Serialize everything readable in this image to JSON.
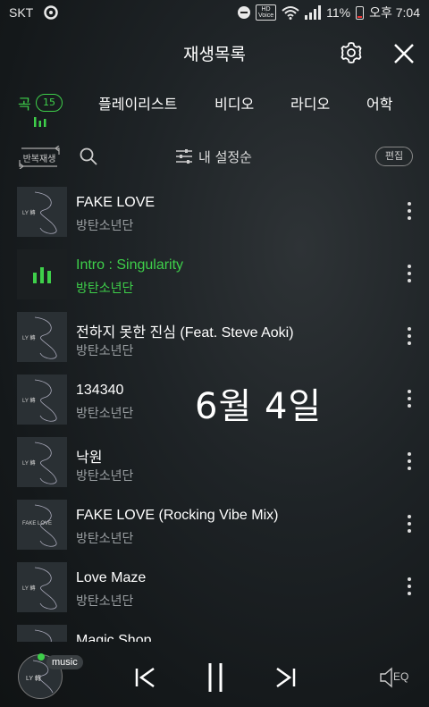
{
  "status_bar": {
    "carrier": "SKT",
    "hd_top": "HD",
    "hd_bottom": "Voice",
    "battery": "11%",
    "time": "오후 7:04"
  },
  "header": {
    "title": "재생목록",
    "icons": [
      "gear-icon",
      "close-icon"
    ]
  },
  "tabs": {
    "songs": "곡",
    "songs_count": "15",
    "playlists": "플레이리스트",
    "video": "비디오",
    "radio": "라디오",
    "language": "어학",
    "accent_color": "#3ecf4a"
  },
  "toolbar": {
    "repeat_label": "반복재생",
    "sort_label": "내 설정순",
    "edit_label": "편집"
  },
  "tracks": [
    {
      "title": "FAKE LOVE",
      "artist": "방탄소년단",
      "playing": false
    },
    {
      "title": "Intro : Singularity",
      "artist": "방탄소년단",
      "playing": true
    },
    {
      "title": "전하지 못한 진심 (Feat. Steve Aoki)",
      "artist": "방탄소년단",
      "playing": false
    },
    {
      "title": "134340",
      "artist": "방탄소년단",
      "playing": false
    },
    {
      "title": "낙원",
      "artist": "방탄소년단",
      "playing": false
    },
    {
      "title": "FAKE LOVE (Rocking Vibe Mix)",
      "artist": "방탄소년단",
      "playing": false
    },
    {
      "title": "Love Maze",
      "artist": "방탄소년단",
      "playing": false
    },
    {
      "title": "Magic Shop",
      "artist": "",
      "playing": false
    }
  ],
  "overlay_text": "6월 4일",
  "player": {
    "badge": "music",
    "eq_label": "EQ"
  }
}
